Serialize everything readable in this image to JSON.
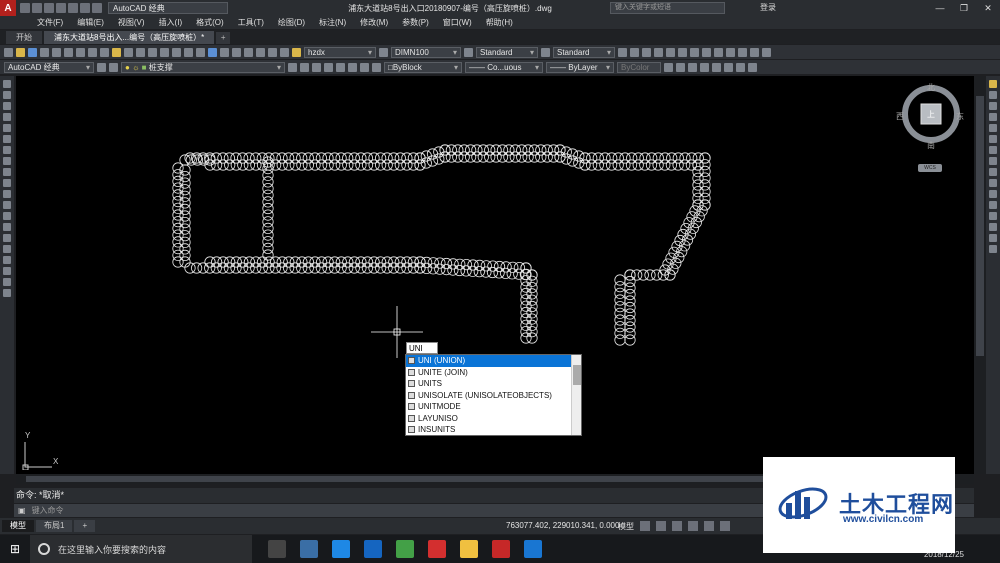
{
  "app": {
    "logo_letter": "A",
    "workspace": "AutoCAD 经典",
    "window_title": "浦东大道站8号出入口20180907-编号（高压旋喷桩）.dwg",
    "search_placeholder": "键入关键字或短语",
    "login_label": "登录"
  },
  "menu": {
    "items": [
      "文件(F)",
      "编辑(E)",
      "视图(V)",
      "插入(I)",
      "格式(O)",
      "工具(T)",
      "绘图(D)",
      "标注(N)",
      "修改(M)",
      "参数(P)",
      "窗口(W)",
      "帮助(H)"
    ]
  },
  "doc_tabs": {
    "start": "开始",
    "current": "浦东大道站8号出入...编号（高压旋喷桩）*",
    "add": "+"
  },
  "toolbar1": {
    "text_style": "hzdx",
    "dim_style": "DIMN100",
    "table_style": "Standard",
    "mleader_style": "Standard"
  },
  "toolbar2": {
    "workspace": "AutoCAD 经典",
    "layer": "桩支撑",
    "color": "ByBlock",
    "linetype": "Co...uous",
    "lineweight": "ByLayer",
    "plotstyle": "ByColor"
  },
  "viewcube": {
    "north": "北",
    "south": "南",
    "east": "东",
    "west": "西",
    "top": "上",
    "wcs": "WCS"
  },
  "command_entry": {
    "typed": "UNI"
  },
  "autocomplete": {
    "items": [
      {
        "label": "UNI (UNION)",
        "selected": true
      },
      {
        "label": "UNITE (JOIN)",
        "selected": false
      },
      {
        "label": "UNITS",
        "selected": false
      },
      {
        "label": "UNISOLATE (UNISOLATEOBJECTS)",
        "selected": false
      },
      {
        "label": "UNITMODE",
        "selected": false
      },
      {
        "label": "LAYUNISO",
        "selected": false
      },
      {
        "label": "INSUNITS",
        "selected": false
      }
    ]
  },
  "ucs": {
    "x": "X",
    "y": "Y"
  },
  "command_line": {
    "history": "命令: *取消*",
    "prompt": "键入命令"
  },
  "layout_tabs": {
    "model": "模型",
    "layout1": "布局1",
    "add": "+"
  },
  "status": {
    "coordinates": "763077.402, 229010.341, 0.000",
    "model_label": "模型"
  },
  "taskbar": {
    "search_placeholder": "在这里输入你要搜索的内容",
    "date": "2018/12/25"
  },
  "watermark": {
    "title": "土木工程网",
    "url": "www.civilcn.com"
  },
  "colors": {
    "canvas_bg": "#000000",
    "selection_blue": "#0a74d6",
    "app_red": "#b3211d",
    "watermark_blue": "#1f4e9c"
  }
}
